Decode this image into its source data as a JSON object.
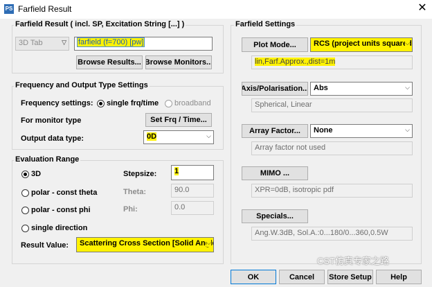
{
  "window": {
    "title": "Farfield Result",
    "icon": "app-icon",
    "close": "✕"
  },
  "farfield_result": {
    "group_title": "Farfield Result ( incl. SP, Excitation String [...] )",
    "tab_select": "3D Tab",
    "result_name": "farfield (f=700) [pw]",
    "browse_results": "Browse Results...",
    "browse_monitors": "Browse Monitors..."
  },
  "frequency": {
    "group_title": "Frequency and Output Type Settings",
    "freq_label": "Frequency settings:",
    "single_label": "single frq/time",
    "broadband_label": "broadband",
    "monitor_label": "For monitor type",
    "set_frq_button": "Set Frq / Time...",
    "output_label": "Output data type:",
    "output_value": "0D"
  },
  "evaluation": {
    "group_title": "Evaluation Range",
    "opt_3d": "3D",
    "opt_polar_theta": "polar - const theta",
    "opt_polar_phi": "polar - const phi",
    "opt_single": "single direction",
    "stepsize_label": "Stepsize:",
    "stepsize_value": "1",
    "theta_label": "Theta:",
    "theta_value": "90.0",
    "phi_label": "Phi:",
    "phi_value": "0.0",
    "result_value_label": "Result Value:",
    "result_value": "Scattering Cross Section [Solid Angle"
  },
  "farfield_settings": {
    "group_title": "Farfield Settings",
    "plot_mode_button": "Plot Mode...",
    "plot_mode_value": "RCS (project units squared",
    "plot_mode_info": "lin,Farf.Approx.,dist=1m",
    "axis_button": "Axis/Polarisation...",
    "axis_value": "Abs",
    "axis_info": "Spherical, Linear",
    "array_button": "Array Factor...",
    "array_value": "None",
    "array_info": "Array factor not used",
    "mimo_button": "MIMO ...",
    "mimo_info": "XPR=0dB, isotropic pdf",
    "specials_button": "Specials...",
    "specials_info": "Ang.W.3dB, Sol.A.:0...180/0...360,0.5W"
  },
  "footer": {
    "ok": "OK",
    "cancel": "Cancel",
    "store": "Store Setup",
    "help": "Help"
  },
  "watermark": "CST仿真专家之路",
  "highlight_color": "#fff200",
  "accent_color": "#0078d7"
}
